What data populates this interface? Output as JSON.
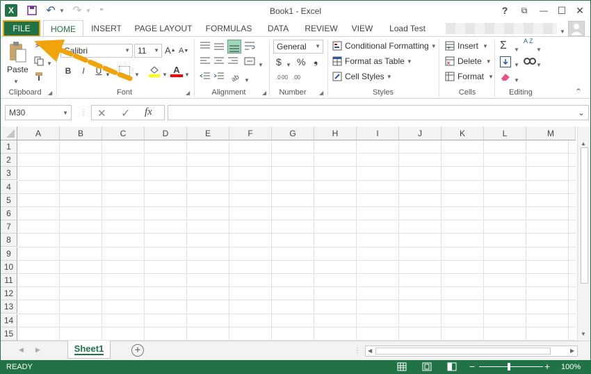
{
  "window": {
    "title": "Book1 - Excel",
    "help": "?",
    "restore": "⧉",
    "minimize": "—",
    "maximize": "☐",
    "close": "✕"
  },
  "quick_access": {
    "app_icon": "X",
    "save": "💾",
    "undo": "↶",
    "redo": "↷",
    "customize": "⁼"
  },
  "tabs": [
    {
      "label": "FILE"
    },
    {
      "label": "HOME"
    },
    {
      "label": "INSERT"
    },
    {
      "label": "PAGE LAYOUT"
    },
    {
      "label": "FORMULAS"
    },
    {
      "label": "DATA"
    },
    {
      "label": "REVIEW"
    },
    {
      "label": "VIEW"
    },
    {
      "label": "Load Test"
    }
  ],
  "ribbon": {
    "clipboard": {
      "label": "Clipboard",
      "paste": "Paste"
    },
    "font": {
      "label": "Font",
      "name": "Calibri",
      "size": "11",
      "bold": "B",
      "italic": "I",
      "underline": "U",
      "grow": "A",
      "shrink": "A",
      "font_color": "A"
    },
    "alignment": {
      "label": "Alignment"
    },
    "number": {
      "label": "Number",
      "format": "General",
      "currency": "$",
      "percent": "%",
      "comma": "❟"
    },
    "styles": {
      "label": "Styles",
      "conditional": "Conditional Formatting",
      "table": "Format as Table",
      "cell_styles": "Cell Styles"
    },
    "cells": {
      "label": "Cells",
      "insert": "Insert",
      "delete": "Delete",
      "format": "Format"
    },
    "editing": {
      "label": "Editing",
      "sum": "Σ",
      "sort": "A Z"
    }
  },
  "formula_bar": {
    "name_box": "M30",
    "cancel": "✕",
    "enter": "✓",
    "fx": "fx",
    "value": ""
  },
  "columns": [
    "A",
    "B",
    "C",
    "D",
    "E",
    "F",
    "G",
    "H",
    "I",
    "J",
    "K",
    "L",
    "M"
  ],
  "rows": [
    "1",
    "2",
    "3",
    "4",
    "5",
    "6",
    "7",
    "8",
    "9",
    "10",
    "11",
    "12",
    "13",
    "14",
    "15"
  ],
  "sheets": {
    "active": "Sheet1",
    "add": "+"
  },
  "status": {
    "text": "READY",
    "zoom": "100%",
    "minus": "−",
    "plus": "+"
  },
  "colors": {
    "accent": "#217346",
    "highlight": "#f0a30a"
  }
}
